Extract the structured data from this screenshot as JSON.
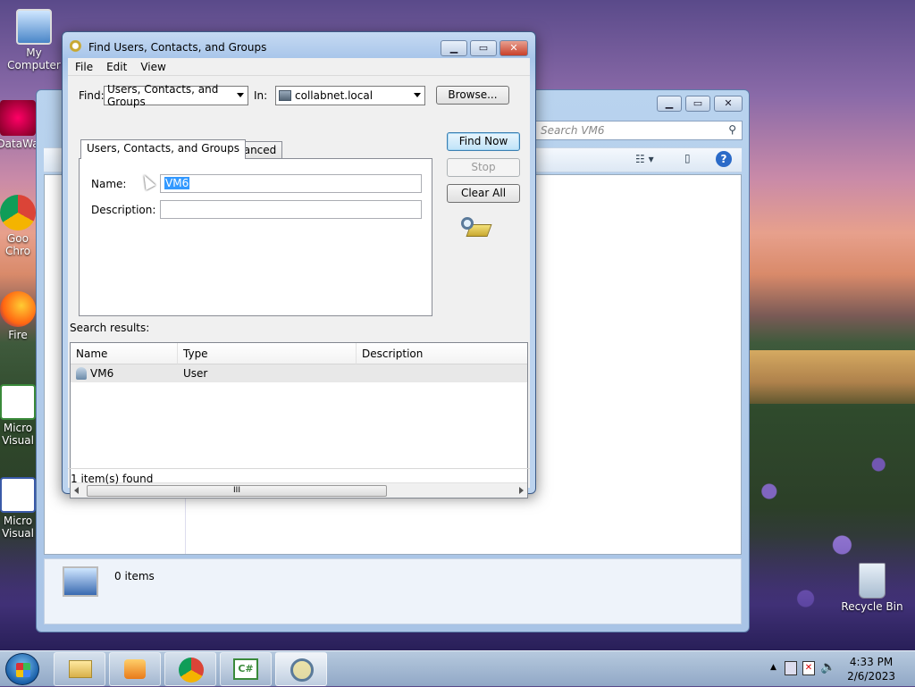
{
  "desktop": {
    "icons": [
      {
        "label": "My Computer"
      },
      {
        "label": "DataWa"
      },
      {
        "label": "Goo Chro"
      },
      {
        "label": "Fire"
      },
      {
        "label": "Micro Visual"
      },
      {
        "label": "Micro Visual"
      }
    ],
    "recycle_bin": "Recycle Bin"
  },
  "explorer": {
    "search_placeholder": "Search VM6",
    "status_count": "0 items"
  },
  "dialog": {
    "title": "Find Users, Contacts, and Groups",
    "menu": [
      "File",
      "Edit",
      "View"
    ],
    "find_label": "Find:",
    "find_value": "Users, Contacts, and Groups",
    "in_label": "In:",
    "in_value": "collabnet.local",
    "browse_label": "Browse...",
    "tabs": [
      "Users, Contacts, and Groups",
      "Advanced"
    ],
    "name_label": "Name:",
    "name_value": "VM6",
    "description_label": "Description:",
    "description_value": "",
    "find_now_label": "Find Now",
    "stop_label": "Stop",
    "clear_all_label": "Clear All",
    "search_results_label": "Search results:",
    "columns": [
      "Name",
      "Type",
      "Description"
    ],
    "rows": [
      {
        "name": "VM6",
        "type": "User",
        "description": ""
      }
    ],
    "scroll_grip": "III",
    "status": "1 item(s) found"
  },
  "taskbar": {
    "time": "4:33 PM",
    "date": "2/6/2023",
    "csharp_label": "C#"
  },
  "colors": {
    "accent": "#3399ff",
    "title_bar": "#bcd3ee"
  }
}
